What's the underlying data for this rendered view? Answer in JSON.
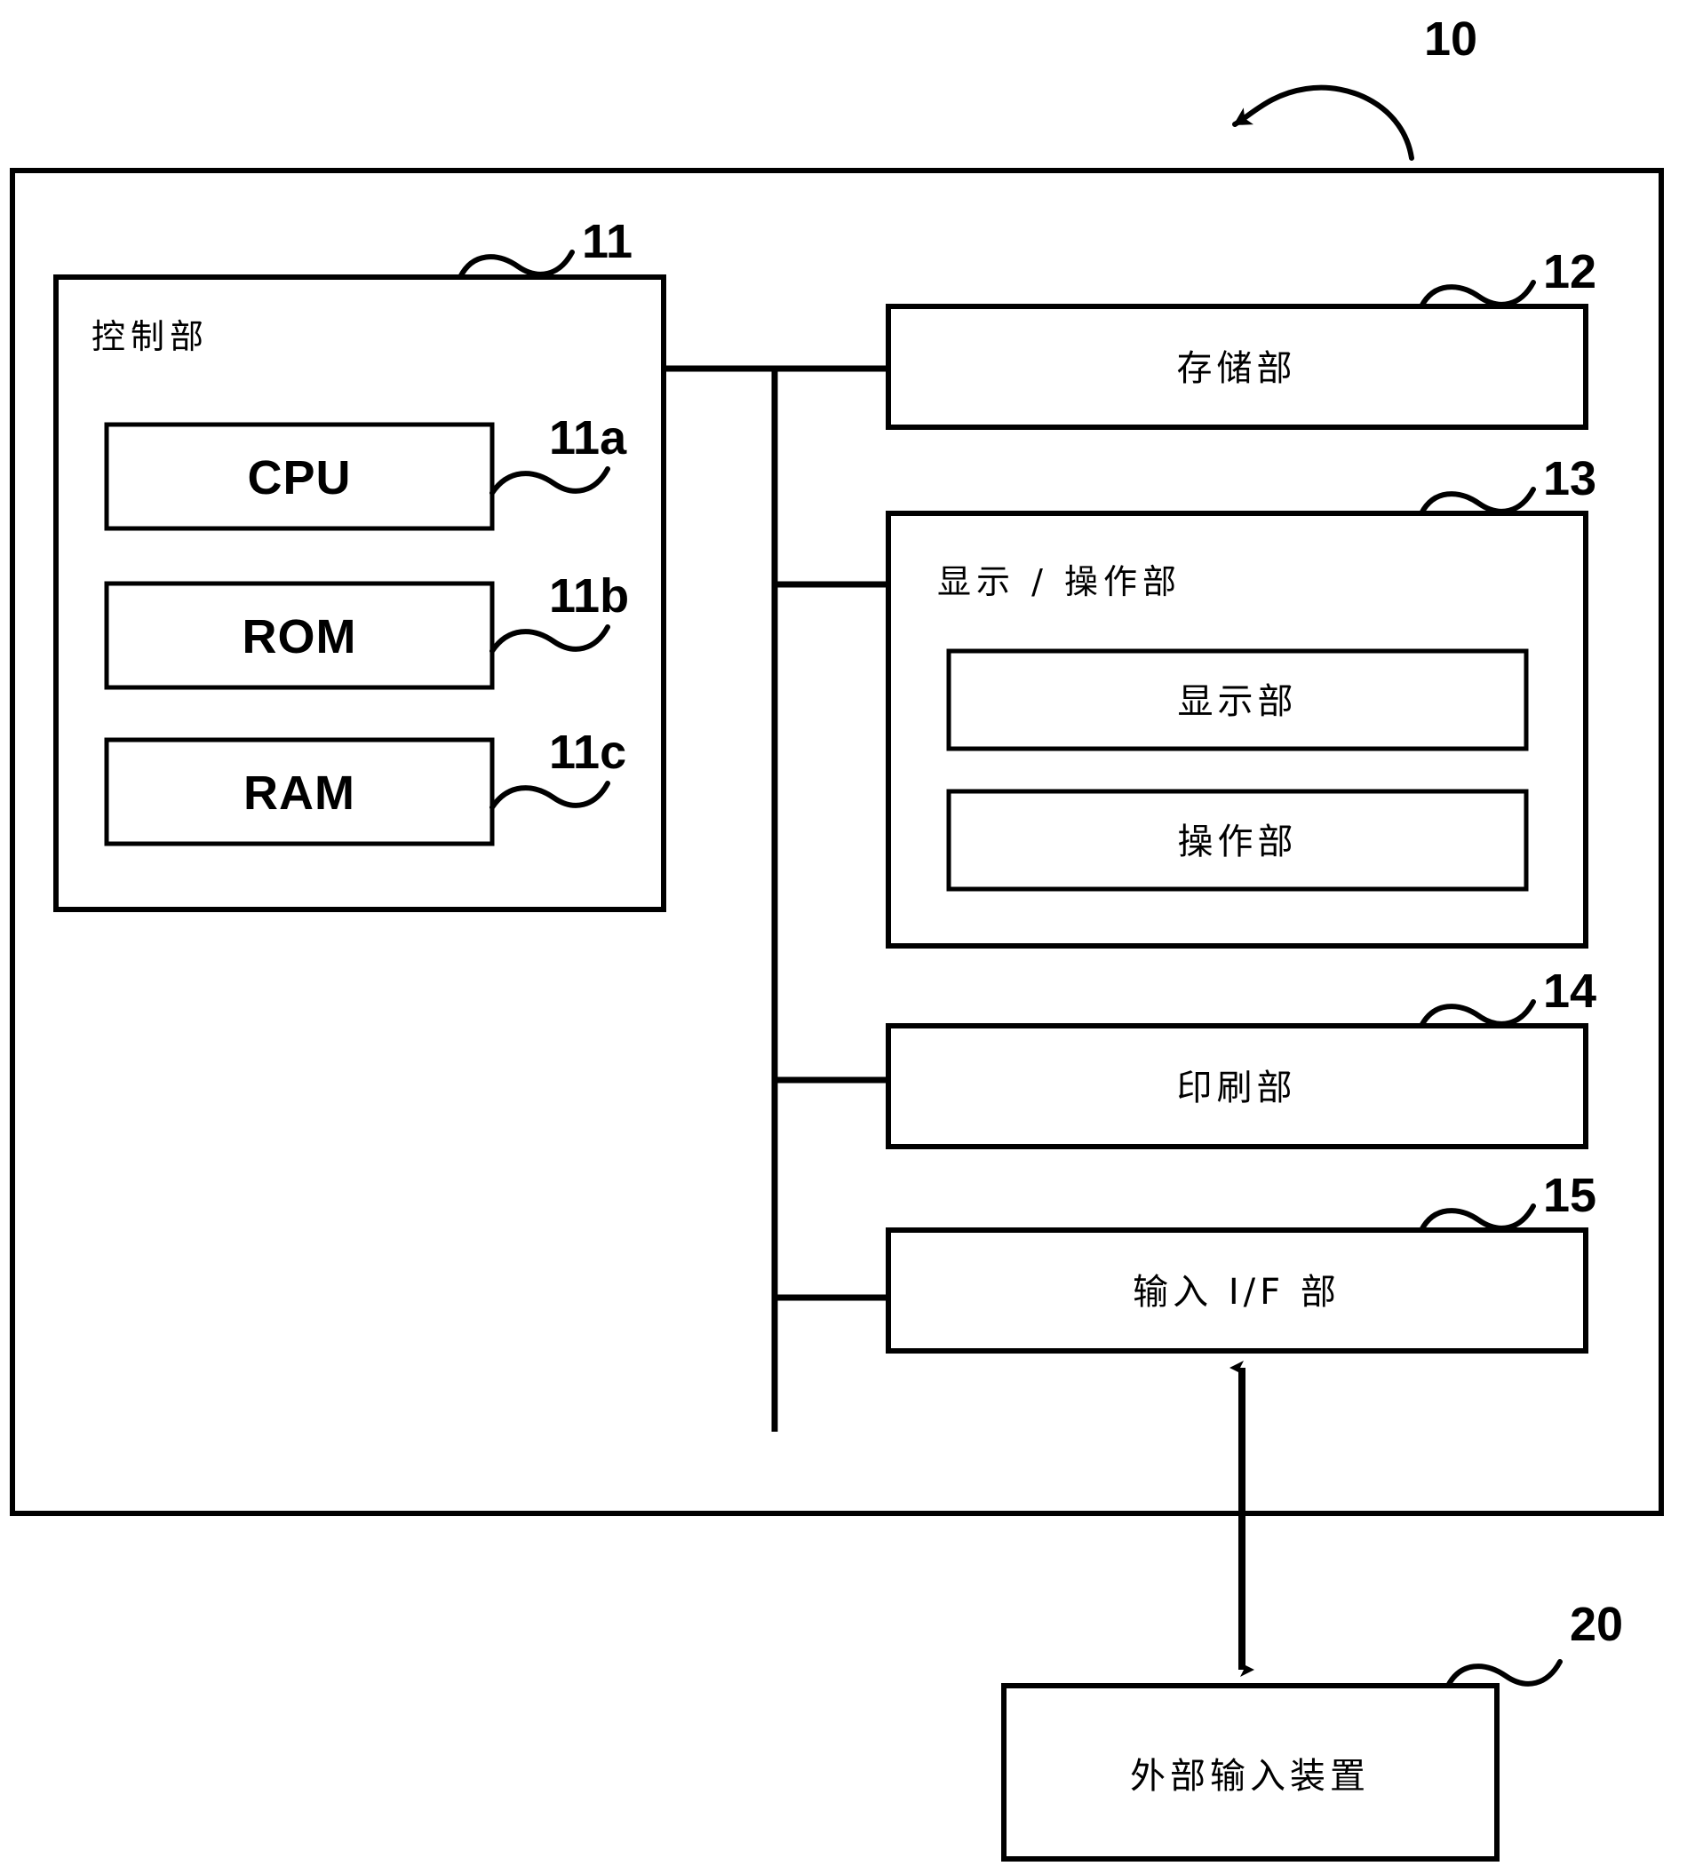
{
  "figure": {
    "type": "patent-block-diagram",
    "background_color": "#ffffff",
    "line_color": "#000000"
  },
  "reference_numerals": {
    "device": "10",
    "control_unit": "11",
    "cpu": "11a",
    "rom": "11b",
    "ram": "11c",
    "storage_unit": "12",
    "display_operation_unit": "13",
    "printing_unit": "14",
    "input_if_unit": "15",
    "external_input_device": "20"
  },
  "blocks": {
    "device": {
      "label": "",
      "ref": "10"
    },
    "control_unit": {
      "label": "控制部",
      "ref": "11"
    },
    "cpu": {
      "label": "CPU",
      "ref": "11a"
    },
    "rom": {
      "label": "ROM",
      "ref": "11b"
    },
    "ram": {
      "label": "RAM",
      "ref": "11c"
    },
    "storage_unit": {
      "label": "存储部",
      "ref": "12"
    },
    "display_operation_unit": {
      "label": "显示 / 操作部",
      "ref": "13"
    },
    "display_unit": {
      "label": "显示部",
      "ref": ""
    },
    "operation_unit": {
      "label": "操作部",
      "ref": ""
    },
    "printing_unit": {
      "label": "印刷部",
      "ref": "14"
    },
    "input_if_unit": {
      "label": "输入 I/F 部",
      "ref": "15"
    },
    "external_input_device": {
      "label": "外部输入装置",
      "ref": "20"
    }
  },
  "connectors": {
    "bus_name": "internal-bus",
    "external_link": "bidirectional-arrow"
  }
}
